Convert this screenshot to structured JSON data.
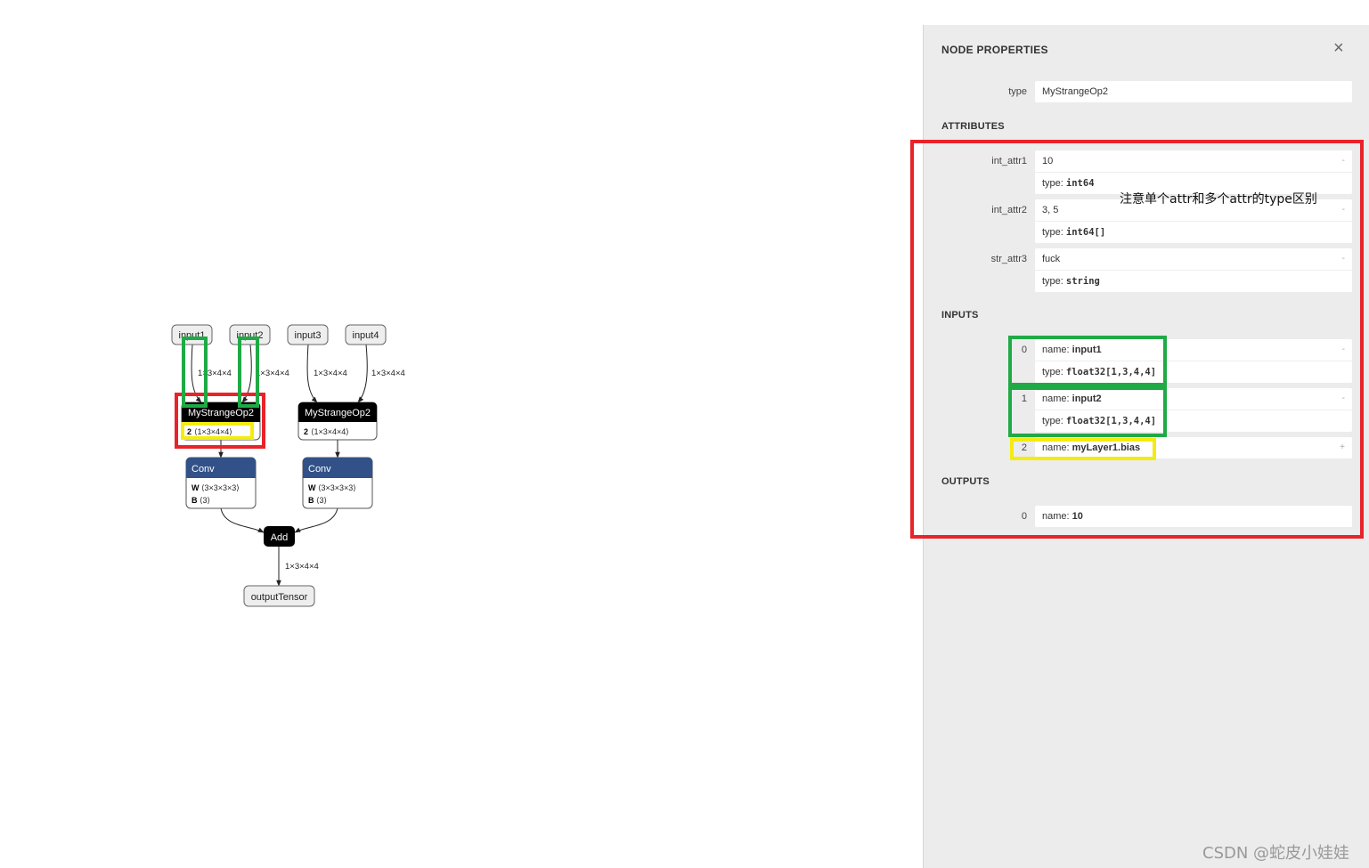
{
  "graph": {
    "inputs": [
      "input1",
      "input2",
      "input3",
      "input4"
    ],
    "edge_labels": [
      "1×3×4×4",
      "1×3×4×4",
      "1×3×4×4",
      "1×3×4×4"
    ],
    "strange_ops": [
      {
        "title": "MyStrangeOp2",
        "detail_key": "2",
        "detail_val": "⟨1×3×4×4⟩"
      },
      {
        "title": "MyStrangeOp2",
        "detail_key": "2",
        "detail_val": "⟨1×3×4×4⟩"
      }
    ],
    "convs": [
      {
        "title": "Conv",
        "w_key": "W",
        "w_val": "⟨3×3×3×3⟩",
        "b_key": "B",
        "b_val": "⟨3⟩"
      },
      {
        "title": "Conv",
        "w_key": "W",
        "w_val": "⟨3×3×3×3⟩",
        "b_key": "B",
        "b_val": "⟨3⟩"
      }
    ],
    "add": "Add",
    "add_edge_label": "1×3×4×4",
    "output": "outputTensor"
  },
  "panel": {
    "title": "NODE PROPERTIES",
    "close_icon": "×",
    "type_label": "type",
    "type_value": "MyStrangeOp2",
    "attributes_header": "ATTRIBUTES",
    "attributes": [
      {
        "name": "int_attr1",
        "value": "10",
        "type_prefix": "type: ",
        "type": "int64",
        "toggle": "-"
      },
      {
        "name": "int_attr2",
        "value": "3, 5",
        "type_prefix": "type: ",
        "type": "int64[]",
        "toggle": "-"
      },
      {
        "name": "str_attr3",
        "value": "fuck",
        "type_prefix": "type: ",
        "type": "string",
        "toggle": "-"
      }
    ],
    "inputs_header": "INPUTS",
    "inputs": [
      {
        "index": "0",
        "name_prefix": "name: ",
        "name": "input1",
        "type_prefix": "type: ",
        "type": "float32[1,3,4,4]",
        "toggle": "-"
      },
      {
        "index": "1",
        "name_prefix": "name: ",
        "name": "input2",
        "type_prefix": "type: ",
        "type": "float32[1,3,4,4]",
        "toggle": "-"
      },
      {
        "index": "2",
        "name_prefix": "name: ",
        "name": "myLayer1.bias",
        "toggle": "+"
      }
    ],
    "outputs_header": "OUTPUTS",
    "outputs": [
      {
        "index": "0",
        "name_prefix": "name: ",
        "name": "10"
      }
    ]
  },
  "annotation_note": "注意单个attr和多个attr的type区别",
  "watermark": "CSDN @蛇皮小娃娃",
  "colors": {
    "annotation_red": "#e8232a",
    "annotation_green": "#1faa45",
    "annotation_yellow": "#f3ec12",
    "conv_header": "#325188",
    "panel_bg": "#ececec"
  }
}
